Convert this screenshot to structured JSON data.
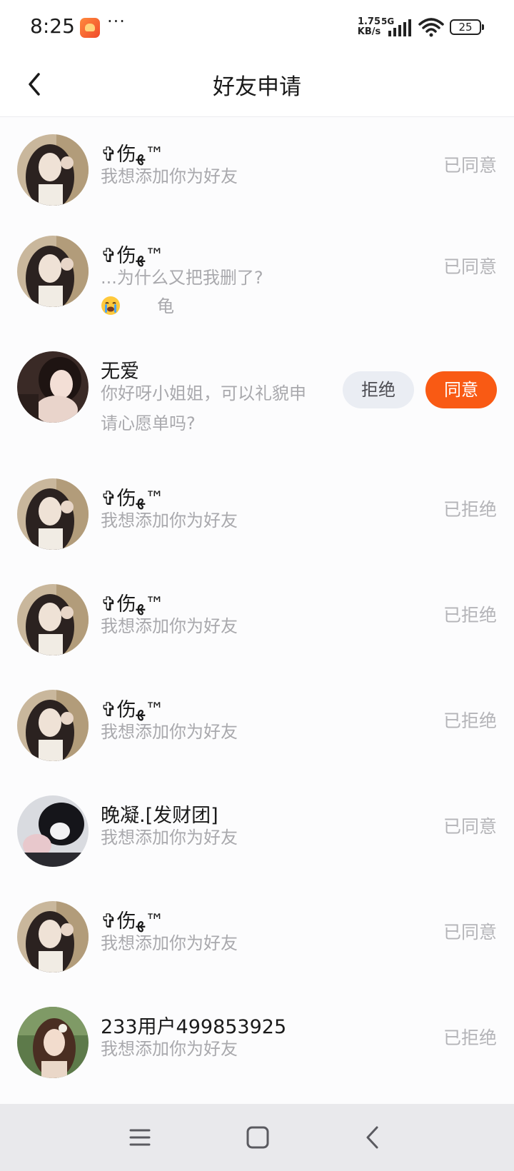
{
  "status_bar": {
    "time": "8:25",
    "more": "···",
    "net_speed_value": "1.75",
    "net_speed_unit": "KB/s",
    "net_type": "5G",
    "battery": "25",
    "icons": [
      "app-notification-icon",
      "signal-icon",
      "wifi-icon",
      "battery-icon"
    ]
  },
  "header": {
    "title": "好友申请",
    "back_icon": "chevron-left-icon"
  },
  "requests": [
    {
      "name": "✞伤ﻬ™",
      "message": "我想添加你为好友",
      "status": "已同意",
      "avatar": "girl-long-hair"
    },
    {
      "name": "✞伤ﻬ™",
      "message": "...为什么又把我删了?",
      "message_extra": "龟",
      "emoji": "crying-face-icon",
      "status": "已同意",
      "avatar": "girl-long-hair"
    },
    {
      "name": "无爱",
      "message": "你好呀小姐姐，可以礼貌申请心愿单吗?",
      "avatar": "girl-dark",
      "reject_label": "拒绝",
      "accept_label": "同意"
    },
    {
      "name": "✞伤ﻬ™",
      "message": "我想添加你为好友",
      "status": "已拒绝",
      "avatar": "girl-long-hair"
    },
    {
      "name": "✞伤ﻬ™",
      "message": "我想添加你为好友",
      "status": "已拒绝",
      "avatar": "girl-long-hair"
    },
    {
      "name": "✞伤ﻬ™",
      "message": "我想添加你为好友",
      "status": "已拒绝",
      "avatar": "girl-long-hair"
    },
    {
      "name": "晚凝.[发财团]",
      "message": "我想添加你为好友",
      "status": "已同意",
      "avatar": "anime-black-hair"
    },
    {
      "name": "✞伤ﻬ™",
      "message": "我想添加你为好友",
      "status": "已同意",
      "avatar": "girl-long-hair"
    },
    {
      "name": "233用户499853925",
      "message": "我想添加你为好友",
      "status": "已拒绝",
      "avatar": "girl-outdoor"
    }
  ],
  "nav_bar": {
    "icons": [
      "menu-icon",
      "home-icon",
      "back-icon"
    ]
  },
  "colors": {
    "accent": "#f95a14",
    "reject_bg": "#eaedf3",
    "muted_text": "#a9a9ad",
    "status_text": "#b4b4b8"
  }
}
